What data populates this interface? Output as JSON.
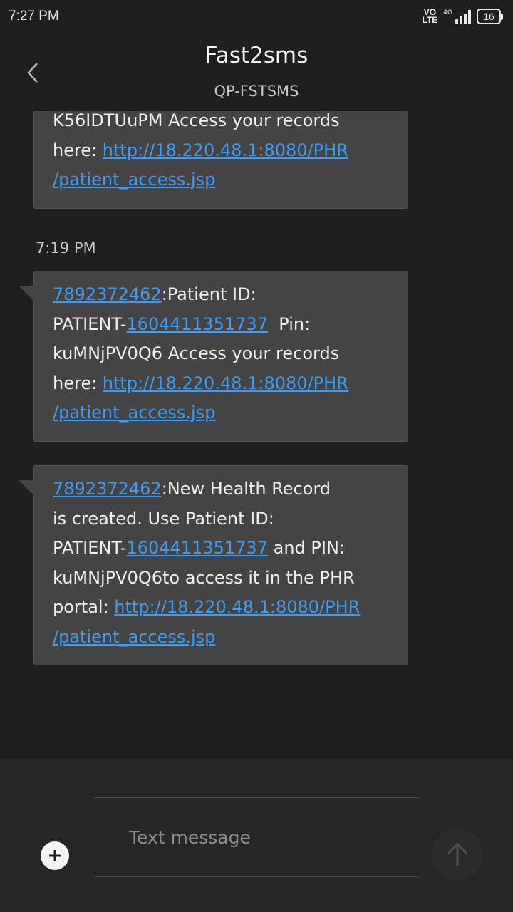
{
  "status_bar": {
    "time": "7:27 PM",
    "volte_top": "VO",
    "volte_bottom": "LTE",
    "network": "4G",
    "battery": "16"
  },
  "header": {
    "title": "Fast2sms",
    "subtitle": "QP-FSTSMS",
    "back_icon": "chevron-left-icon"
  },
  "messages": [
    {
      "lines": [
        [
          {
            "t": "K56IDTUuPM Access your records"
          }
        ],
        [
          {
            "t": "here: "
          },
          {
            "t": "http://18.220.48.1:8080/PHR",
            "link": true
          }
        ],
        [
          {
            "t": "/patient_access.jsp",
            "link": true
          }
        ]
      ]
    },
    {
      "lines": [
        [
          {
            "t": "7892372462",
            "link": true
          },
          {
            "t": ":Patient ID:"
          }
        ],
        [
          {
            "t": "PATIENT-"
          },
          {
            "t": "1604411351737",
            "link": true
          },
          {
            "t": "  Pin:"
          }
        ],
        [
          {
            "t": "kuMNjPV0Q6 Access your records"
          }
        ],
        [
          {
            "t": "here: "
          },
          {
            "t": "http://18.220.48.1:8080/PHR",
            "link": true
          }
        ],
        [
          {
            "t": "/patient_access.jsp",
            "link": true
          }
        ]
      ]
    },
    {
      "lines": [
        [
          {
            "t": "7892372462",
            "link": true
          },
          {
            "t": ":New Health Record"
          }
        ],
        [
          {
            "t": "is created. Use Patient ID:"
          }
        ],
        [
          {
            "t": "PATIENT-"
          },
          {
            "t": "1604411351737",
            "link": true
          },
          {
            "t": " and PIN:"
          }
        ],
        [
          {
            "t": "kuMNjPV0Q6to access it in the PHR"
          }
        ],
        [
          {
            "t": "portal: "
          },
          {
            "t": "http://18.220.48.1:8080/PHR",
            "link": true
          }
        ],
        [
          {
            "t": "/patient_access.jsp",
            "link": true
          }
        ]
      ]
    }
  ],
  "time_separator": "7:19 PM",
  "composer": {
    "placeholder": "Text message",
    "add_icon": "plus-icon",
    "send_icon": "arrow-up-icon"
  },
  "colors": {
    "background": "#1f1f1f",
    "bubble": "#444444",
    "link": "#3d9cf5"
  }
}
